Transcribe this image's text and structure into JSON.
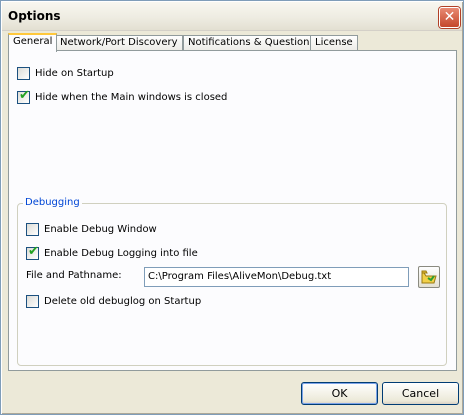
{
  "window": {
    "title": "Options",
    "close_label": "✕"
  },
  "tabs": [
    {
      "label": "General",
      "active": true
    },
    {
      "label": "Network/Port Discovery",
      "active": false
    },
    {
      "label": "Notifications & Questions",
      "active": false
    },
    {
      "label": "License",
      "active": false
    }
  ],
  "general": {
    "hide_on_startup": {
      "label": "Hide on Startup",
      "checked": false
    },
    "hide_when_closed": {
      "label": "Hide when the Main windows is closed",
      "checked": true
    }
  },
  "debugging": {
    "group_title": "Debugging",
    "enable_debug_window": {
      "label": "Enable Debug Window",
      "checked": false
    },
    "enable_debug_logging": {
      "label": "Enable Debug Logging into file",
      "checked": true
    },
    "file_label": "File and Pathname:",
    "file_path": "C:\\Program Files\\AliveMon\\Debug.txt",
    "delete_old_log": {
      "label": "Delete old debuglog on Startup",
      "checked": false
    },
    "browse_icon": "folder-open-icon"
  },
  "buttons": {
    "ok": "OK",
    "cancel": "Cancel"
  }
}
